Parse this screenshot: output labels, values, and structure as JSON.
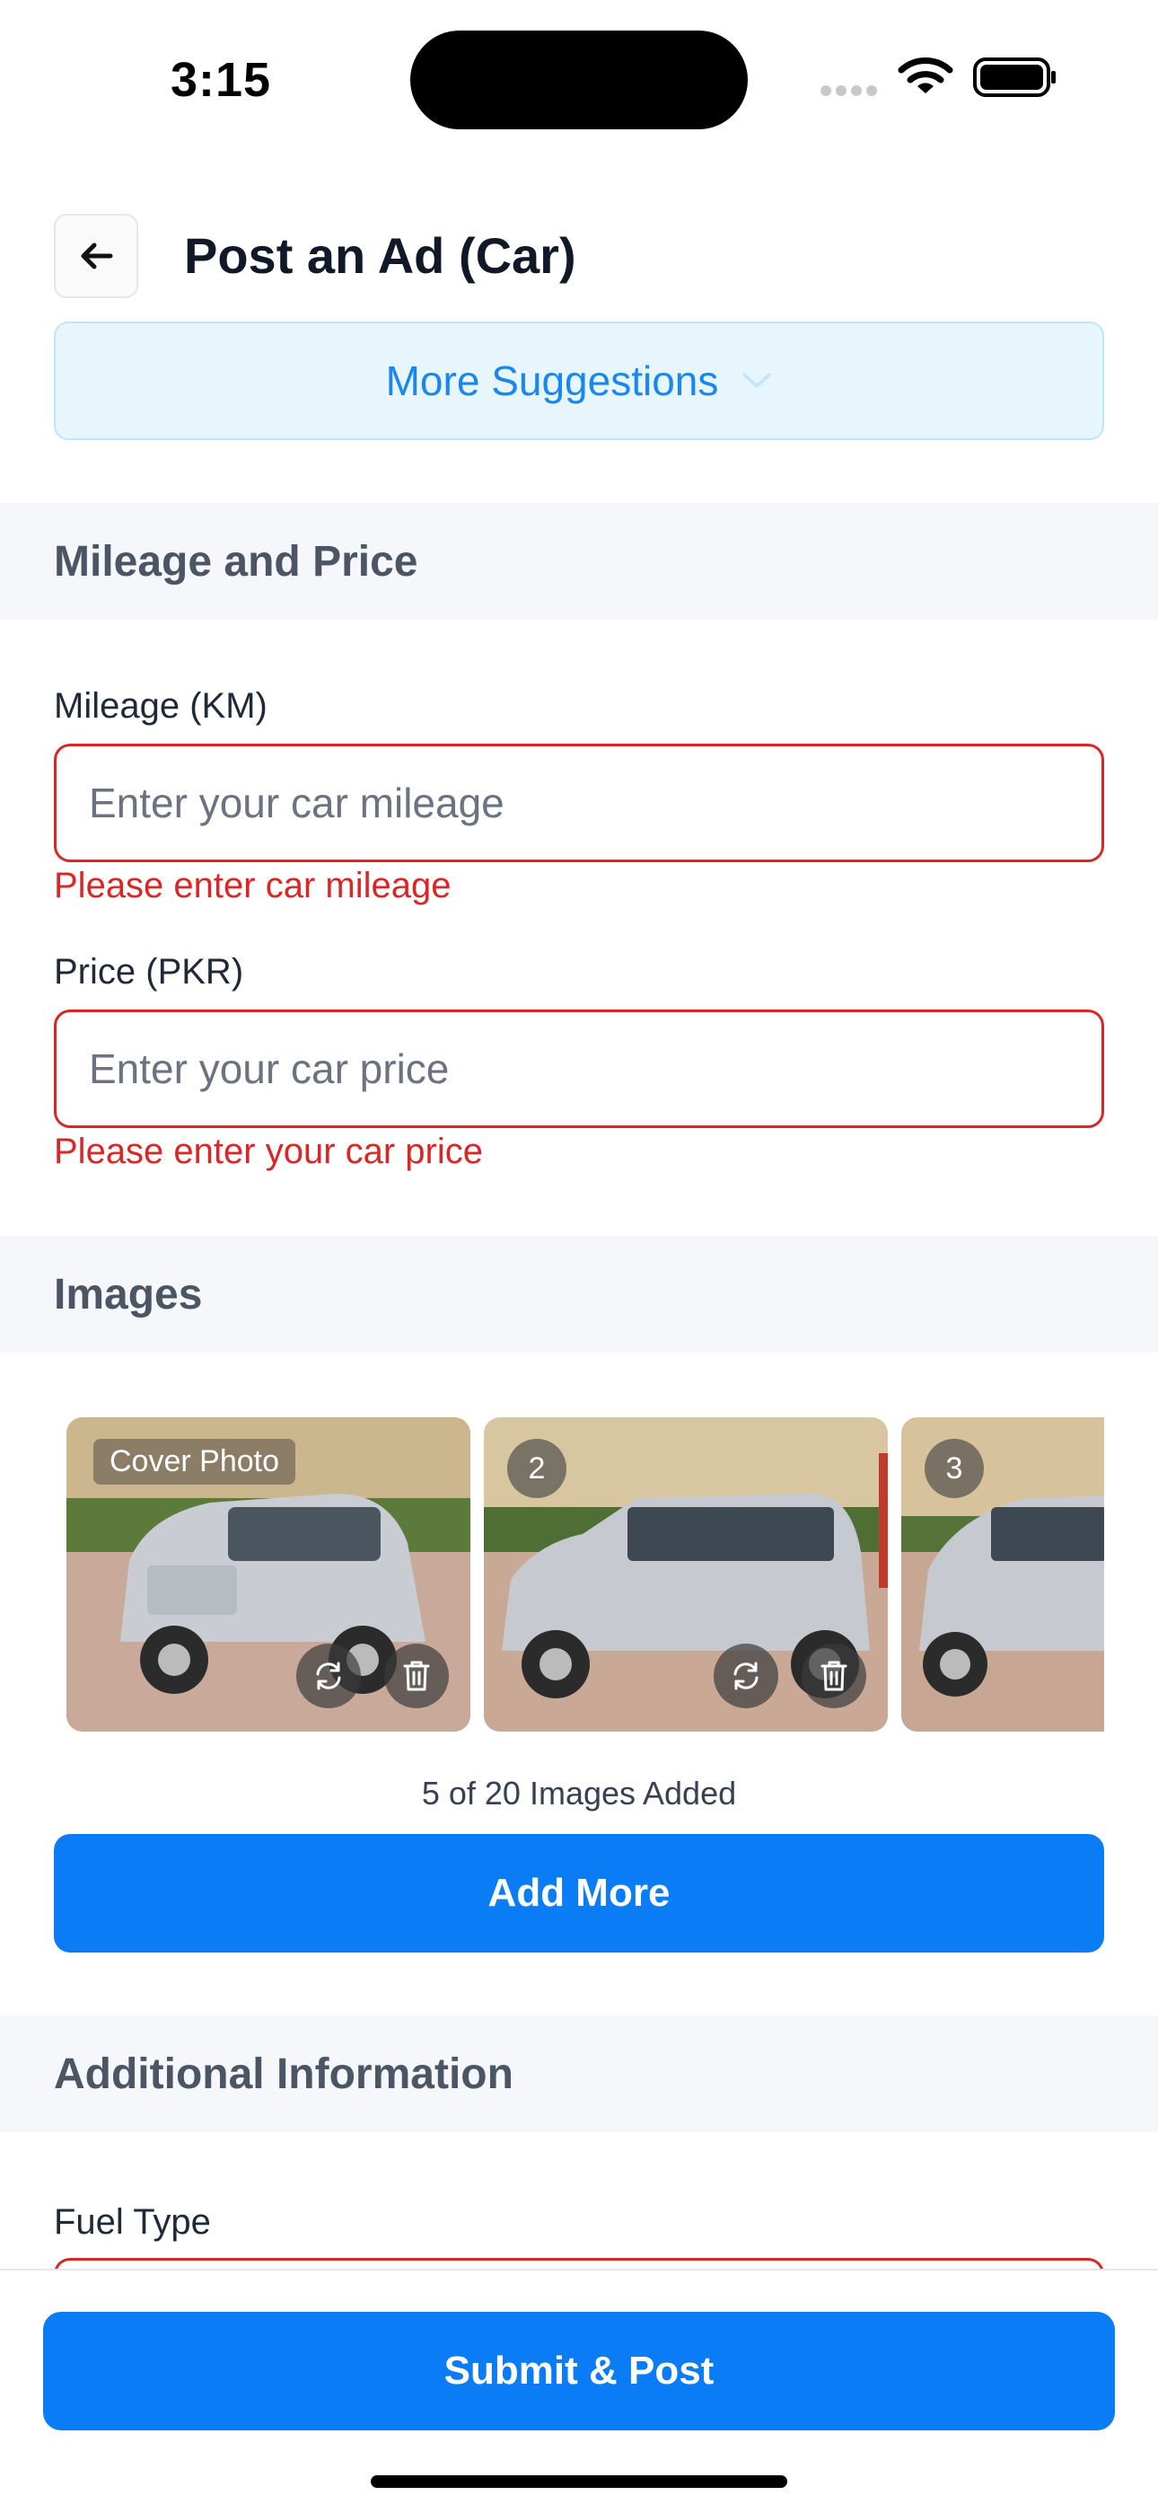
{
  "status_bar": {
    "time": "3:15"
  },
  "header": {
    "title": "Post an Ad (Car)"
  },
  "suggestions": {
    "label": "More Suggestions"
  },
  "sections": {
    "mileage_price": "Mileage and Price",
    "images": "Images",
    "additional": "Additional Information"
  },
  "fields": {
    "mileage": {
      "label": "Mileage (KM)",
      "placeholder": "Enter your car mileage",
      "value": "",
      "error": "Please enter car mileage"
    },
    "price": {
      "label": "Price (PKR)",
      "placeholder": "Enter your car price",
      "value": "",
      "error": "Please enter your car price"
    },
    "fuel": {
      "label": "Fuel Type"
    }
  },
  "images": {
    "items": [
      {
        "badge": "Cover Photo"
      },
      {
        "badge": "2"
      },
      {
        "badge": "3"
      }
    ],
    "count_text": "5 of 20 Images Added",
    "add_more": "Add More"
  },
  "footer": {
    "submit": "Submit & Post"
  },
  "colors": {
    "accent": "#0a7cf5",
    "error": "#dc2626",
    "suggest_bg": "#e7f6fd"
  }
}
